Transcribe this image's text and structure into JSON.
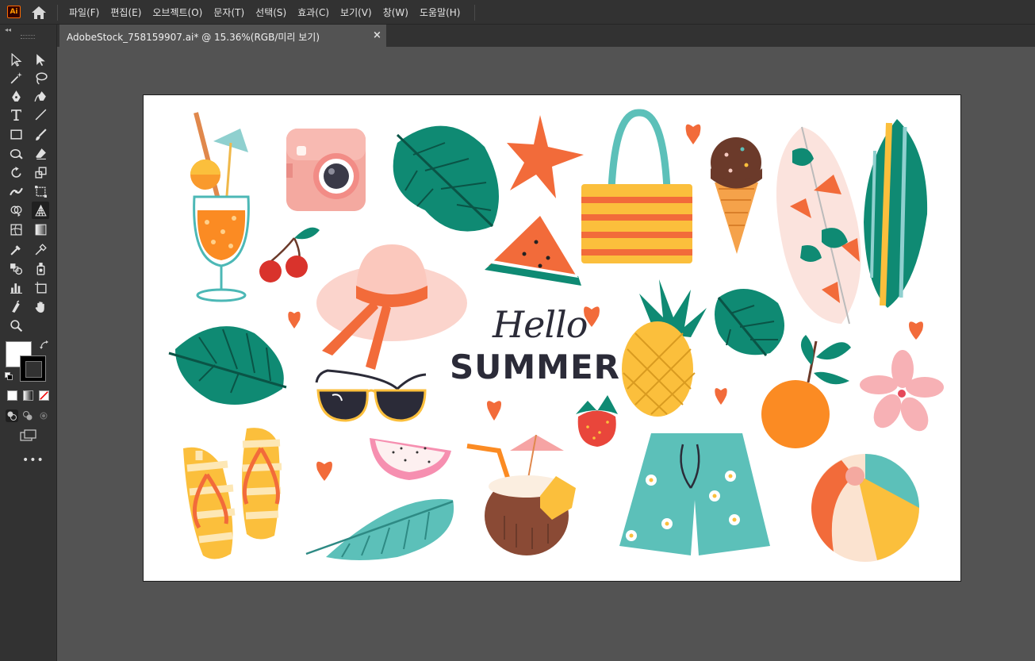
{
  "app": {
    "logo_text": "Ai"
  },
  "menu": {
    "items": [
      "파일(F)",
      "편집(E)",
      "오브젝트(O)",
      "문자(T)",
      "선택(S)",
      "효과(C)",
      "보기(V)",
      "창(W)",
      "도움말(H)"
    ]
  },
  "document_tab": {
    "title": "AdobeStock_758159907.ai* @ 15.36%(RGB/미리 보기)",
    "close_label": "×"
  },
  "toolbar": {
    "collapse_label": "◂◂",
    "more_label": "•••",
    "tools": [
      "selection-tool-icon",
      "direct-selection-tool-icon",
      "magic-wand-tool-icon",
      "lasso-tool-icon",
      "pen-tool-icon",
      "curvature-tool-icon",
      "type-tool-icon",
      "line-segment-tool-icon",
      "rectangle-tool-icon",
      "paintbrush-tool-icon",
      "shaper-tool-icon",
      "eraser-tool-icon",
      "rotate-tool-icon",
      "scale-tool-icon",
      "width-tool-icon",
      "free-transform-tool-icon",
      "shape-builder-tool-icon",
      "perspective-grid-tool-icon",
      "mesh-tool-icon",
      "gradient-tool-icon",
      "eyedropper-tool-icon",
      "measure-tool-icon",
      "blend-tool-icon",
      "symbol-sprayer-tool-icon",
      "column-graph-tool-icon",
      "artboard-tool-icon",
      "slice-tool-icon",
      "hand-tool-icon",
      "zoom-tool-icon"
    ],
    "fill_color": "#ffffff",
    "stroke_color": "#000000"
  },
  "artboard": {
    "hello_text": "Hello",
    "summer_text": "SUMMER"
  },
  "colors": {
    "ui_dark": "#323232",
    "workspace": "#535353",
    "teal": "#0f8a73",
    "orange": "#f26b3a",
    "yellow": "#fbbf3c",
    "pink": "#f6c9c0",
    "text_dark": "#2b2b38"
  }
}
